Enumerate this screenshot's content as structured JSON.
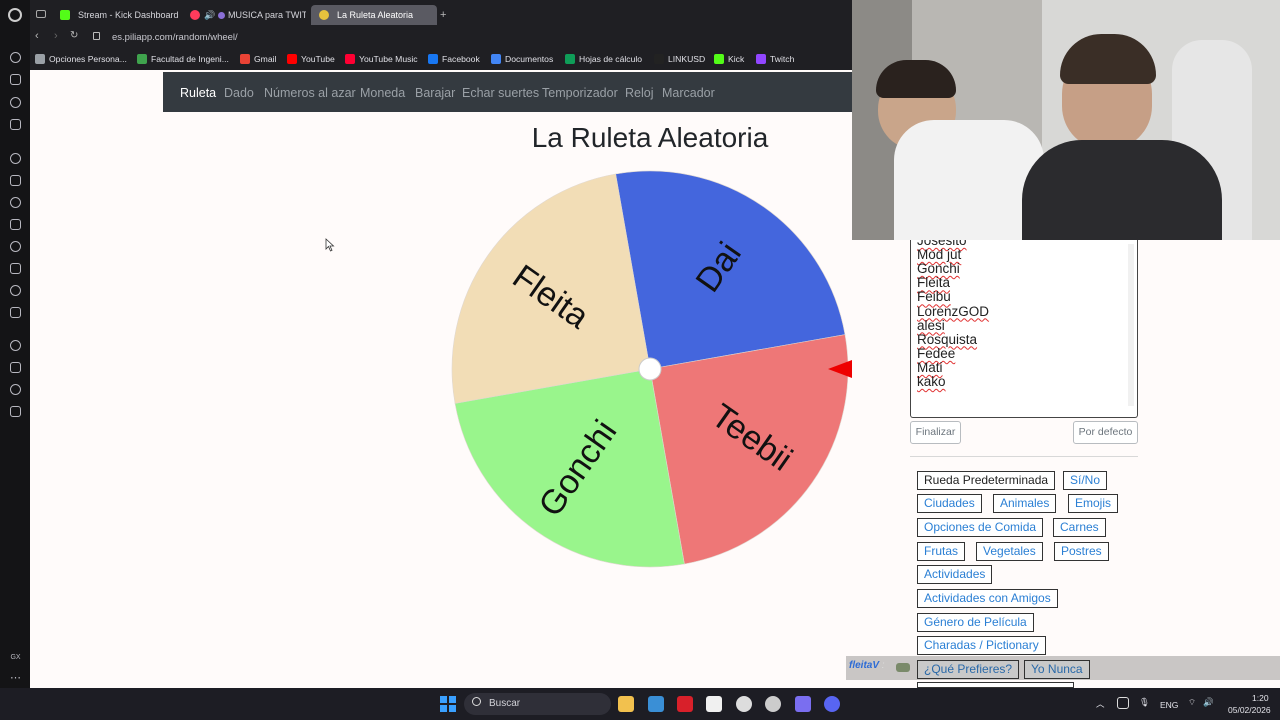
{
  "browser": {
    "tabs": [
      {
        "label": "Stream - Kick Dashboard",
        "color": "#53fc18"
      },
      {
        "label": "MUSICA para TWIT",
        "color": "#ff3b5c"
      },
      {
        "label": "La Ruleta Aleatoria",
        "color": "#e7c23d"
      }
    ],
    "address": "es.piliapp.com/random/wheel/",
    "bookmarks": [
      {
        "label": "Opciones Persona...",
        "color": "#9aa0a6"
      },
      {
        "label": "Facultad de Ingeni...",
        "color": "#3fa34d"
      },
      {
        "label": "Gmail",
        "color": "#ea4335"
      },
      {
        "label": "YouTube",
        "color": "#ff0000"
      },
      {
        "label": "YouTube Music",
        "color": "#ff0033"
      },
      {
        "label": "Facebook",
        "color": "#1877f2"
      },
      {
        "label": "Documentos",
        "color": "#4285f4"
      },
      {
        "label": "Hojas de cálculo",
        "color": "#0f9d58"
      },
      {
        "label": "LINKUSD",
        "color": "#222222"
      },
      {
        "label": "Kick",
        "color": "#53fc18"
      },
      {
        "label": "Twitch",
        "color": "#9146ff"
      }
    ],
    "sidebar_icons": [
      "opera-logo-icon",
      "history-icon",
      "flow-icon",
      "games-icon",
      "messenger-icon",
      "chatgpt-icon",
      "twitch-icon",
      "facebook-messenger-icon",
      "whatsapp-icon",
      "telegram-icon",
      "instagram-icon",
      "tiktok-icon",
      "x-icon",
      "player-icon",
      "clock-icon",
      "extensions-icon",
      "settings-icon",
      "gx-icon",
      "more-icon"
    ],
    "sidebar_gx": "GX"
  },
  "nav": {
    "items": [
      "Ruleta",
      "Dado",
      "Números al azar",
      "Moneda",
      "Barajar",
      "Echar suertes",
      "Temporizador",
      "Reloj",
      "Marcador"
    ],
    "active": "Ruleta"
  },
  "title": "La Ruleta Aleatoria",
  "wheel": {
    "segments": [
      {
        "label": "Dai",
        "color": "#4466dd"
      },
      {
        "label": "Teebii",
        "color": "#ee7777"
      },
      {
        "label": "Gonchi",
        "color": "#99f58c"
      },
      {
        "label": "Fleita",
        "color": "#f2ddb6"
      }
    ],
    "pointer_color": "#ee0000"
  },
  "names_list": [
    "Josesito",
    "Mod jut",
    "Gonchi",
    "Fleita",
    "Feibu",
    "LorenzGOD",
    "alesi",
    "Rosquista",
    "Fedee",
    "Mati",
    "kako"
  ],
  "buttons": {
    "finalize": "Finalizar",
    "default": "Por defecto"
  },
  "presets": [
    "Rueda Predeterminada",
    "Sí/No",
    "Ciudades",
    "Animales",
    "Emojis",
    "Opciones de Comida",
    "Carnes",
    "Frutas",
    "Vegetales",
    "Postres",
    "Actividades",
    "Actividades con Amigos",
    "Género de Película",
    "Charadas / Pictionary",
    "¿Qué Prefieres?",
    "Yo Nunca"
  ],
  "overlay": {
    "user": "fleitaV",
    "separator": ":"
  },
  "taskbar": {
    "search": "Buscar",
    "lang": "ENG",
    "time": "1:20",
    "date": "05/02/2026"
  }
}
